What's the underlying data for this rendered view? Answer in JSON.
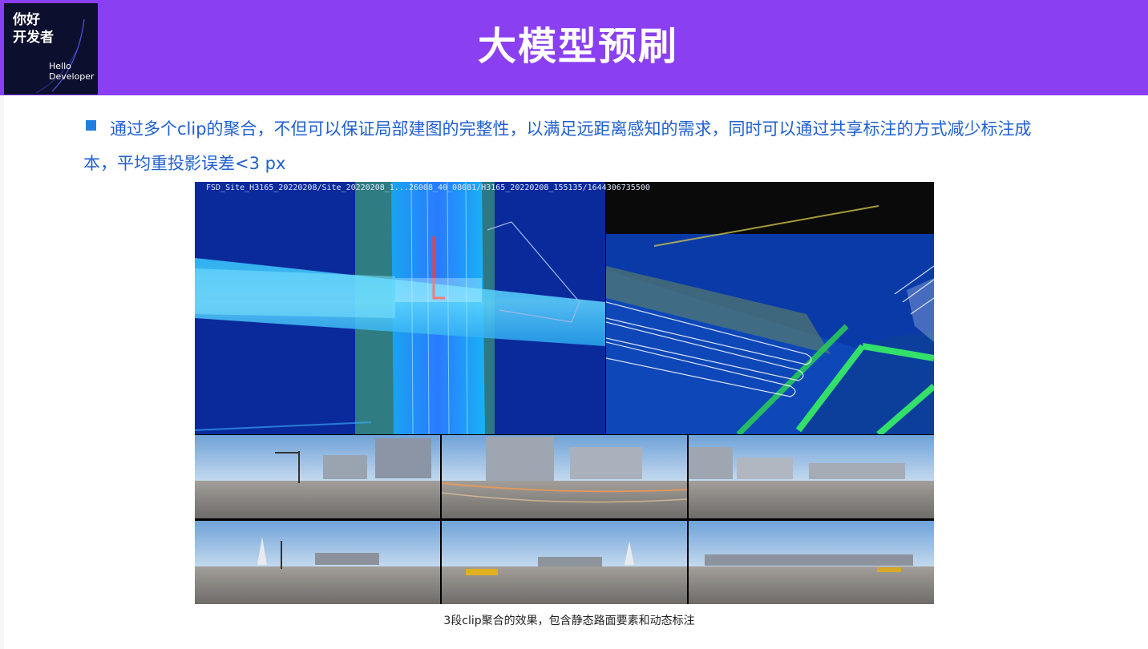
{
  "logo": {
    "line1": "你好",
    "line2": "开发者",
    "en_line1": "Hello",
    "en_line2": "Developer"
  },
  "header": {
    "title": "大模型预刷"
  },
  "bullet": {
    "text": "通过多个clip的聚合，不但可以保证局部建图的完整性，以满足远距离感知的需求，同时可以通过共享标注的方式减少标注成本，平均重投影误差<3 px"
  },
  "figure": {
    "path_label": "FSD_Site_H3165_20220208/Site_20220208_1...26008_40_08081/H3165_20220208_155135/1644306735500",
    "caption": "3段clip聚合的效果，包含静态路面要素和动态标注"
  },
  "colors": {
    "header_bg": "#8a3ff0",
    "logo_bg": "#0d0f2e",
    "bullet_text": "#1f5fd1",
    "bullet_marker": "#1f7fe0"
  }
}
